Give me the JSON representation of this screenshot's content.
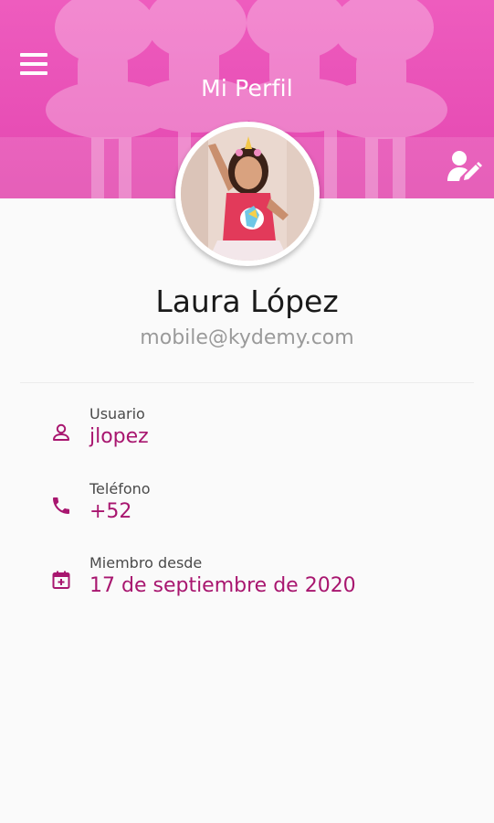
{
  "header": {
    "title": "Mi Perfil",
    "menu_icon": "menu-icon",
    "edit_icon": "edit-profile-icon",
    "brand_color": "#e84fb6"
  },
  "profile": {
    "name": "Laura López",
    "email": "mobile@kydemy.com"
  },
  "details": [
    {
      "label": "Usuario",
      "value": "jlopez",
      "icon": "user-icon"
    },
    {
      "label": "Teléfono",
      "value": "+52",
      "icon": "phone-icon"
    },
    {
      "label": "Miembro desde",
      "value": "17 de septiembre de 2020",
      "icon": "calendar-add-icon"
    }
  ],
  "accent_color": "#a8166f"
}
